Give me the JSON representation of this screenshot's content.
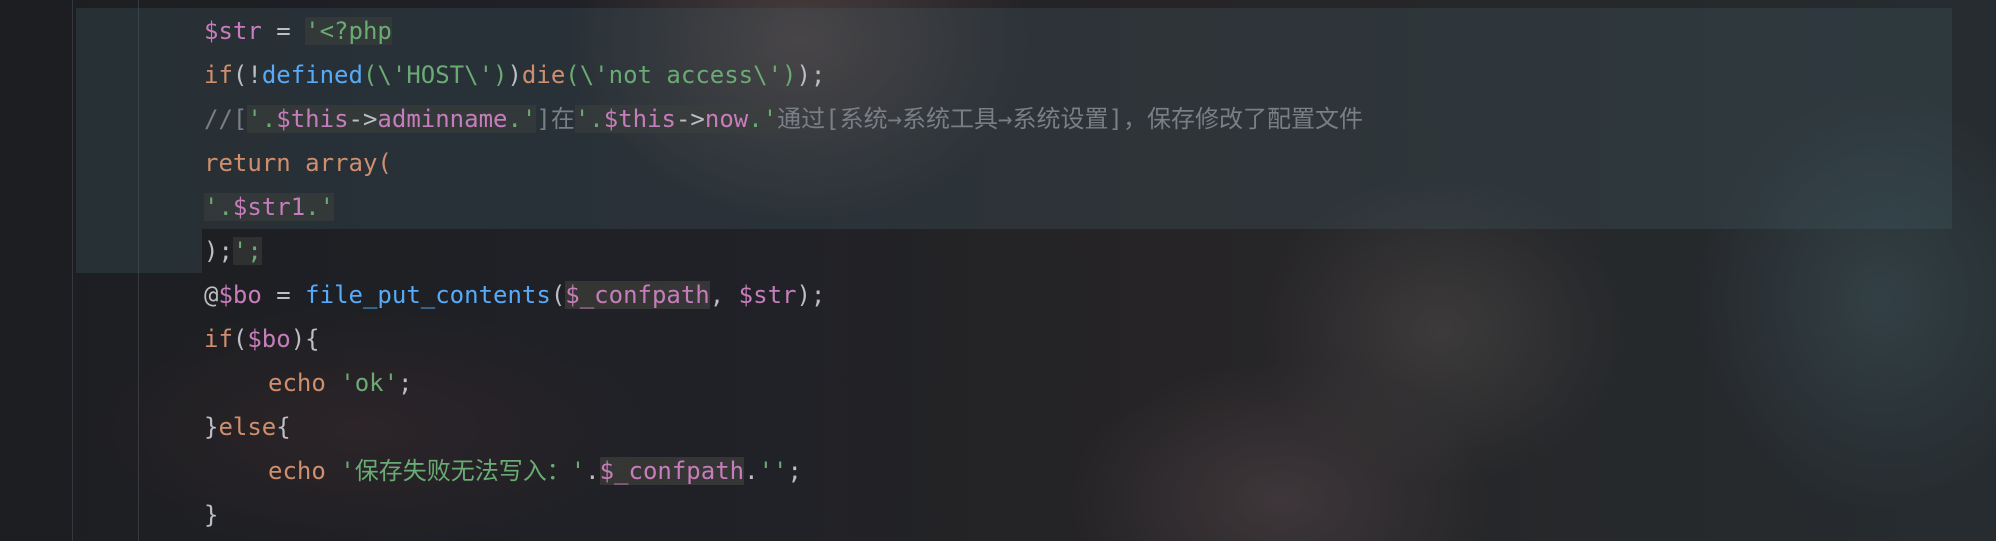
{
  "code_lines": [
    {
      "tokens": [
        "$str",
        " = ",
        "'<?php"
      ]
    },
    {
      "tokens": [
        "if",
        "(!",
        "defined",
        "(\\'HOST\\')",
        ")",
        "die",
        "(\\'not access\\')",
        ");"
      ]
    },
    {
      "tokens": [
        "//[",
        "'.",
        "$this",
        "->",
        "adminname",
        ".'",
        "]在",
        "'.",
        "$this",
        "->",
        "now",
        ".'",
        "通过[系统→系统工具→系统设置]，保存修改了配置文件"
      ]
    },
    {
      "tokens": [
        "return array("
      ]
    },
    {
      "tokens": [
        "'.",
        "$str1",
        ".'"
      ]
    },
    {
      "tokens": [
        ");",
        "';"
      ]
    },
    {
      "tokens": [
        "@",
        "$bo",
        " = ",
        "file_put_contents",
        "(",
        "$_confpath",
        ", ",
        "$str",
        ");"
      ]
    },
    {
      "tokens": [
        "if",
        "(",
        "$bo",
        "){"
      ]
    },
    {
      "tokens": [
        "echo",
        " ",
        "'ok'",
        ";"
      ]
    },
    {
      "tokens": [
        "}",
        "else",
        "{"
      ]
    },
    {
      "tokens": [
        "echo",
        " ",
        "'保存失败无法写入：'",
        ".",
        "$_confpath",
        ".",
        "''",
        ";"
      ]
    },
    {
      "tokens": [
        "}"
      ]
    }
  ],
  "colors": {
    "variable": "#c77dbb",
    "keyword": "#cf8e6d",
    "function": "#57aaf7",
    "string": "#6aab73",
    "comment": "#7a7e85",
    "default": "#bcbec4"
  }
}
